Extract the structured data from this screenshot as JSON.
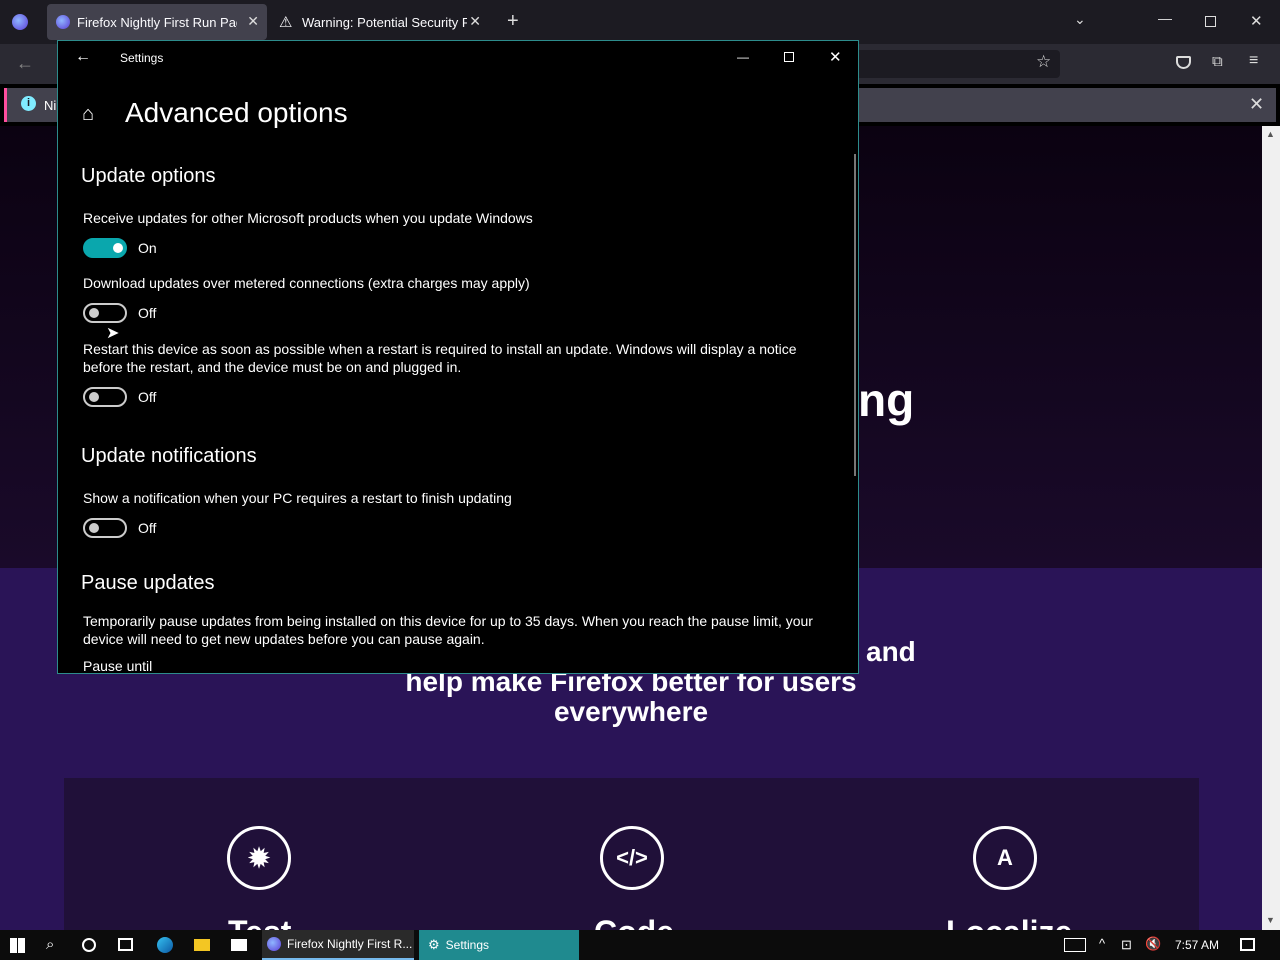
{
  "browser": {
    "tabs": [
      {
        "title": "Firefox Nightly First Run Page",
        "active": true
      },
      {
        "title": "Warning: Potential Security Risk",
        "active": false
      }
    ],
    "infobar_text": "Ni"
  },
  "page": {
    "partial_heading": "ng",
    "partial_and": "and",
    "line2": "help make Firefox better for users",
    "line3": "everywhere",
    "cards": [
      {
        "icon": "bug-icon",
        "label": "Test"
      },
      {
        "icon": "code-icon",
        "label": "Code"
      },
      {
        "icon": "translate-icon",
        "label": "Localize"
      }
    ]
  },
  "settings": {
    "window_title": "Settings",
    "page_title": "Advanced options",
    "sections": {
      "update_options": "Update options",
      "update_notifications": "Update notifications",
      "pause_updates": "Pause updates"
    },
    "options": [
      {
        "label": "Receive updates for other Microsoft products when you update Windows",
        "state": "On"
      },
      {
        "label": "Download updates over metered connections (extra charges may apply)",
        "state": "Off"
      },
      {
        "label": "Restart this device as soon as possible when a restart is required to install an update. Windows will display a notice before the restart, and the device must be on and plugged in.",
        "state": "Off"
      },
      {
        "label": "Show a notification when your PC requires a restart to finish updating",
        "state": "Off"
      }
    ],
    "pause_desc": "Temporarily pause updates from being installed on this device for up to 35 days. When you reach the pause limit, your device will need to get new updates before you can pause again.",
    "pause_until_label": "Pause until"
  },
  "taskbar": {
    "apps": [
      {
        "label": "Firefox Nightly First R...",
        "icon": "firefox-icon"
      },
      {
        "label": "Settings",
        "icon": "gear-icon"
      }
    ],
    "time": "7:57 AM"
  },
  "colors": {
    "toggle_on": "#0aa7ad",
    "accent_border": "#2d8c8c",
    "page_purple": "#2a1457"
  }
}
